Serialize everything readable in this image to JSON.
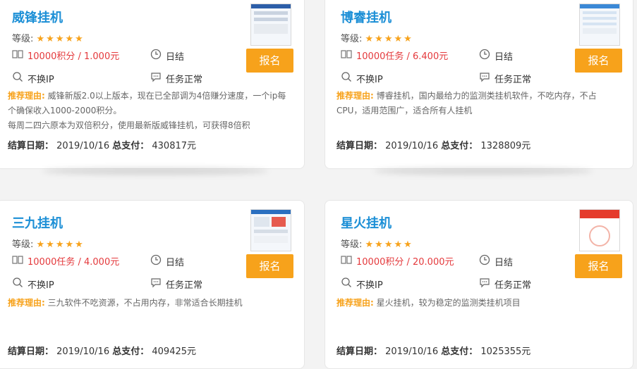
{
  "colors": {
    "title": "#1c8fd6",
    "accent": "#f7a21b",
    "price": "#e4393c"
  },
  "cards": [
    {
      "title": "威锋挂机",
      "grade_label": "等级:",
      "stars": "★★★★★",
      "price": "10000积分 / 1.000元",
      "cycle": "日结",
      "ip": "不换IP",
      "status": "任务正常",
      "button": "报名",
      "reason_label": "推荐理由:",
      "reason": "威锋新版2.0以上版本，现在已全部调为4倍赚分速度，一个ip每个确保收入1000-2000积分。",
      "reason_extra": "每周二四六原本为双倍积分，使用最新版威锋挂机，可获得8倍积",
      "settle_label": "结算日期：",
      "settle_date": "2019/10/16",
      "paid_label": "总支付：",
      "paid_value": "430817元"
    },
    {
      "title": "博睿挂机",
      "grade_label": "等级:",
      "stars": "★★★★★",
      "price": "10000任务 / 6.400元",
      "cycle": "日结",
      "ip": "不换IP",
      "status": "任务正常",
      "button": "报名",
      "reason_label": "推荐理由:",
      "reason": "博睿挂机，国内最给力的监测类挂机软件，不吃内存，不占CPU，适用范围广，适合所有人挂机",
      "reason_extra": "",
      "settle_label": "结算日期：",
      "settle_date": "2019/10/16",
      "paid_label": "总支付：",
      "paid_value": "1328809元"
    },
    {
      "title": "三九挂机",
      "grade_label": "等级:",
      "stars": "★★★★★",
      "price": "10000任务 / 4.000元",
      "cycle": "日结",
      "ip": "不换IP",
      "status": "任务正常",
      "button": "报名",
      "reason_label": "推荐理由:",
      "reason": "三九软件不吃资源，不占用内存，非常适合长期挂机",
      "reason_extra": "",
      "settle_label": "结算日期：",
      "settle_date": "2019/10/16",
      "paid_label": "总支付：",
      "paid_value": "409425元"
    },
    {
      "title": "星火挂机",
      "grade_label": "等级:",
      "stars": "★★★★★",
      "price": "10000积分 / 20.000元",
      "cycle": "日结",
      "ip": "不换IP",
      "status": "任务正常",
      "button": "报名",
      "reason_label": "推荐理由:",
      "reason": "星火挂机，较为稳定的监测类挂机项目",
      "reason_extra": "",
      "settle_label": "结算日期：",
      "settle_date": "2019/10/16",
      "paid_label": "总支付：",
      "paid_value": "1025355元"
    }
  ]
}
